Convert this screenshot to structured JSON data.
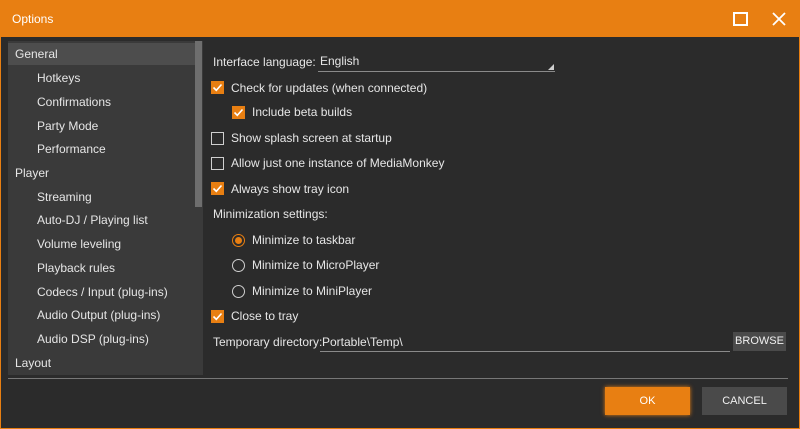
{
  "window": {
    "title": "Options",
    "accent_color": "#e87f12",
    "background_color": "#2b2b2b"
  },
  "sidebar": {
    "items": [
      {
        "label": "General",
        "level": "top",
        "selected": true
      },
      {
        "label": "Hotkeys",
        "level": "sub"
      },
      {
        "label": "Confirmations",
        "level": "sub"
      },
      {
        "label": "Party Mode",
        "level": "sub"
      },
      {
        "label": "Performance",
        "level": "sub"
      },
      {
        "label": "Player",
        "level": "top"
      },
      {
        "label": "Streaming",
        "level": "sub"
      },
      {
        "label": "Auto-DJ / Playing list",
        "level": "sub"
      },
      {
        "label": "Volume leveling",
        "level": "sub"
      },
      {
        "label": "Playback rules",
        "level": "sub"
      },
      {
        "label": "Codecs / Input (plug-ins)",
        "level": "sub"
      },
      {
        "label": "Audio Output (plug-ins)",
        "level": "sub"
      },
      {
        "label": "Audio DSP (plug-ins)",
        "level": "sub"
      },
      {
        "label": "Layout",
        "level": "top"
      }
    ]
  },
  "settings": {
    "language_label": "Interface language:",
    "language_value": "English",
    "check_updates": {
      "label": "Check for updates (when connected)",
      "checked": true
    },
    "include_beta": {
      "label": "Include beta builds",
      "checked": true
    },
    "splash": {
      "label": "Show splash screen at startup",
      "checked": false
    },
    "single_instance": {
      "label": "Allow just one instance of MediaMonkey",
      "checked": false
    },
    "tray_icon": {
      "label": "Always show tray icon",
      "checked": true
    },
    "minimization_label": "Minimization settings:",
    "minimize_options": [
      {
        "label": "Minimize to taskbar",
        "selected": true
      },
      {
        "label": "Minimize to MicroPlayer",
        "selected": false
      },
      {
        "label": "Minimize to MiniPlayer",
        "selected": false
      }
    ],
    "close_to_tray": {
      "label": "Close to tray",
      "checked": true
    },
    "temp_dir_label": "Temporary directory:",
    "temp_dir_value": "Portable\\Temp\\",
    "browse_label": "BROWSE"
  },
  "footer": {
    "ok_label": "OK",
    "cancel_label": "CANCEL"
  }
}
